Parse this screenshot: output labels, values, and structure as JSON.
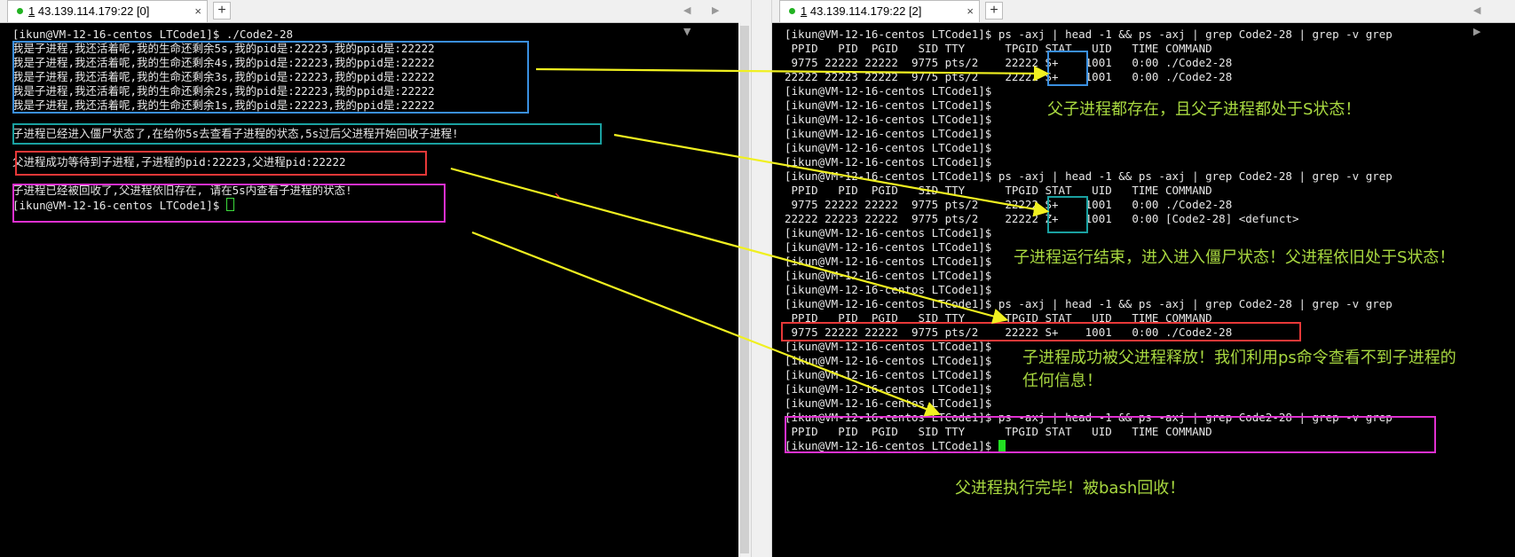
{
  "left": {
    "tab": {
      "dot": "●",
      "index": "1",
      "host": "43.139.114.179:22 [0]",
      "close": "×"
    },
    "add_tab": "+",
    "nav": "◀ ▶ ▼",
    "lines": [
      "[ikun@VM-12-16-centos LTCode1]$ ./Code2-28",
      "我是子进程,我还活着呢,我的生命还剩余5s,我的pid是:22223,我的ppid是:22222",
      "我是子进程,我还活着呢,我的生命还剩余4s,我的pid是:22223,我的ppid是:22222",
      "我是子进程,我还活着呢,我的生命还剩余3s,我的pid是:22223,我的ppid是:22222",
      "我是子进程,我还活着呢,我的生命还剩余2s,我的pid是:22223,我的ppid是:22222",
      "我是子进程,我还活着呢,我的生命还剩余1s,我的pid是:22223,我的ppid是:22222",
      "",
      "子进程已经进入僵尸状态了,在给你5s去查看子进程的状态,5s过后父进程开始回收子进程!",
      "",
      "父进程成功等待到子进程,子进程的pid:22223,父进程pid:22222",
      "",
      "子进程已经被回收了,父进程依旧存在, 请在5s内查看子进程的状态!",
      "[ikun@VM-12-16-centos LTCode1]$ "
    ]
  },
  "right": {
    "tab": {
      "dot": "●",
      "index": "1",
      "host": "43.139.114.179:22 [2]",
      "close": "×"
    },
    "add_tab": "+",
    "nav": "◀ ▶",
    "lines": [
      "[ikun@VM-12-16-centos LTCode1]$ ps -axj | head -1 && ps -axj | grep Code2-28 | grep -v grep",
      " PPID   PID  PGID   SID TTY      TPGID STAT   UID   TIME COMMAND",
      " 9775 22222 22222  9775 pts/2    22222 S+    1001   0:00 ./Code2-28",
      "22222 22223 22222  9775 pts/2    22222 S+    1001   0:00 ./Code2-28",
      "[ikun@VM-12-16-centos LTCode1]$",
      "[ikun@VM-12-16-centos LTCode1]$",
      "[ikun@VM-12-16-centos LTCode1]$",
      "[ikun@VM-12-16-centos LTCode1]$",
      "[ikun@VM-12-16-centos LTCode1]$",
      "[ikun@VM-12-16-centos LTCode1]$",
      "[ikun@VM-12-16-centos LTCode1]$ ps -axj | head -1 && ps -axj | grep Code2-28 | grep -v grep",
      " PPID   PID  PGID   SID TTY      TPGID STAT   UID   TIME COMMAND",
      " 9775 22222 22222  9775 pts/2    22222 S+    1001   0:00 ./Code2-28",
      "22222 22223 22222  9775 pts/2    22222 Z+    1001   0:00 [Code2-28] <defunct>",
      "[ikun@VM-12-16-centos LTCode1]$",
      "[ikun@VM-12-16-centos LTCode1]$",
      "[ikun@VM-12-16-centos LTCode1]$",
      "[ikun@VM-12-16-centos LTCode1]$",
      "[ikun@VM-12-16-centos LTCode1]$",
      "[ikun@VM-12-16-centos LTCode1]$ ps -axj | head -1 && ps -axj | grep Code2-28 | grep -v grep",
      " PPID   PID  PGID   SID TTY      TPGID STAT   UID   TIME COMMAND",
      " 9775 22222 22222  9775 pts/2    22222 S+    1001   0:00 ./Code2-28",
      "[ikun@VM-12-16-centos LTCode1]$",
      "[ikun@VM-12-16-centos LTCode1]$",
      "[ikun@VM-12-16-centos LTCode1]$",
      "[ikun@VM-12-16-centos LTCode1]$",
      "[ikun@VM-12-16-centos LTCode1]$",
      "[ikun@VM-12-16-centos LTCode1]$ ps -axj | head -1 && ps -axj | grep Code2-28 | grep -v grep",
      " PPID   PID  PGID   SID TTY      TPGID STAT   UID   TIME COMMAND",
      "[ikun@VM-12-16-centos LTCode1]$ "
    ]
  },
  "annotations": {
    "a1": "父子进程都存在，且父子进程都处于S状态！",
    "a2": "子进程运行结束，进入进入僵尸状态！父进程依旧处于S状态！",
    "a3_line1": "子进程成功被父进程释放！我们利用ps命令查看不到子进程的",
    "a3_line2": "任何信息！",
    "a4": "父进程执行完毕！被bash回收！"
  },
  "colors": {
    "blue": "#3a8fe0",
    "teal": "#1aa0a0",
    "red": "#e83838",
    "magenta": "#e030d0",
    "arrow": "#f0f020",
    "annotation_text": "#a8d840",
    "cursor": "#22e022"
  }
}
